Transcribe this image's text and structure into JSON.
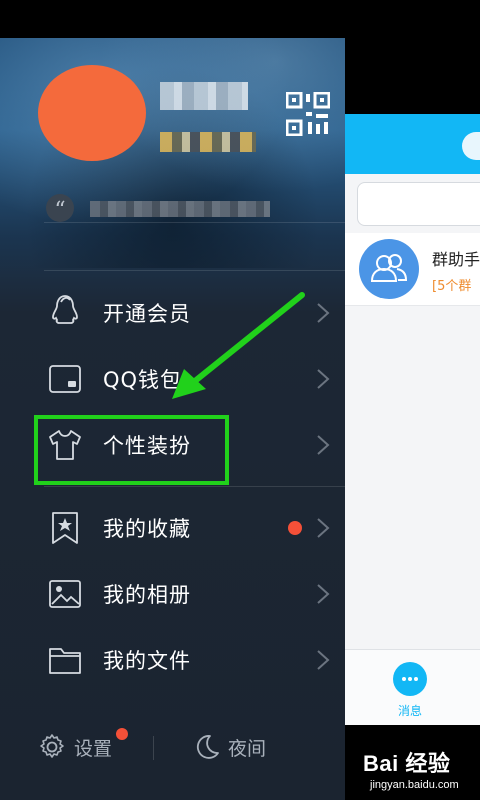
{
  "menu": {
    "items": [
      {
        "label": "开通会员",
        "icon": "penguin-icon"
      },
      {
        "label": "QQ钱包",
        "icon": "wallet-icon"
      },
      {
        "label": "个性装扮",
        "icon": "tshirt-icon"
      },
      {
        "label": "我的收藏",
        "icon": "bookmark-star-icon",
        "has_dot": true
      },
      {
        "label": "我的相册",
        "icon": "image-icon"
      },
      {
        "label": "我的文件",
        "icon": "folder-icon"
      }
    ]
  },
  "footer": {
    "settings_label": "设置",
    "night_label": "夜间"
  },
  "conversation": {
    "title": "群助手",
    "subtitle": "[5个群"
  },
  "tabbar": {
    "messages_label": "消息"
  },
  "watermark": {
    "brand": "Bai 经验",
    "url": "jingyan.baidu.com"
  },
  "colors": {
    "accent": "#12b7f5",
    "highlight": "#21d11b",
    "notification": "#f45038",
    "avatar": "#f46a3c"
  }
}
